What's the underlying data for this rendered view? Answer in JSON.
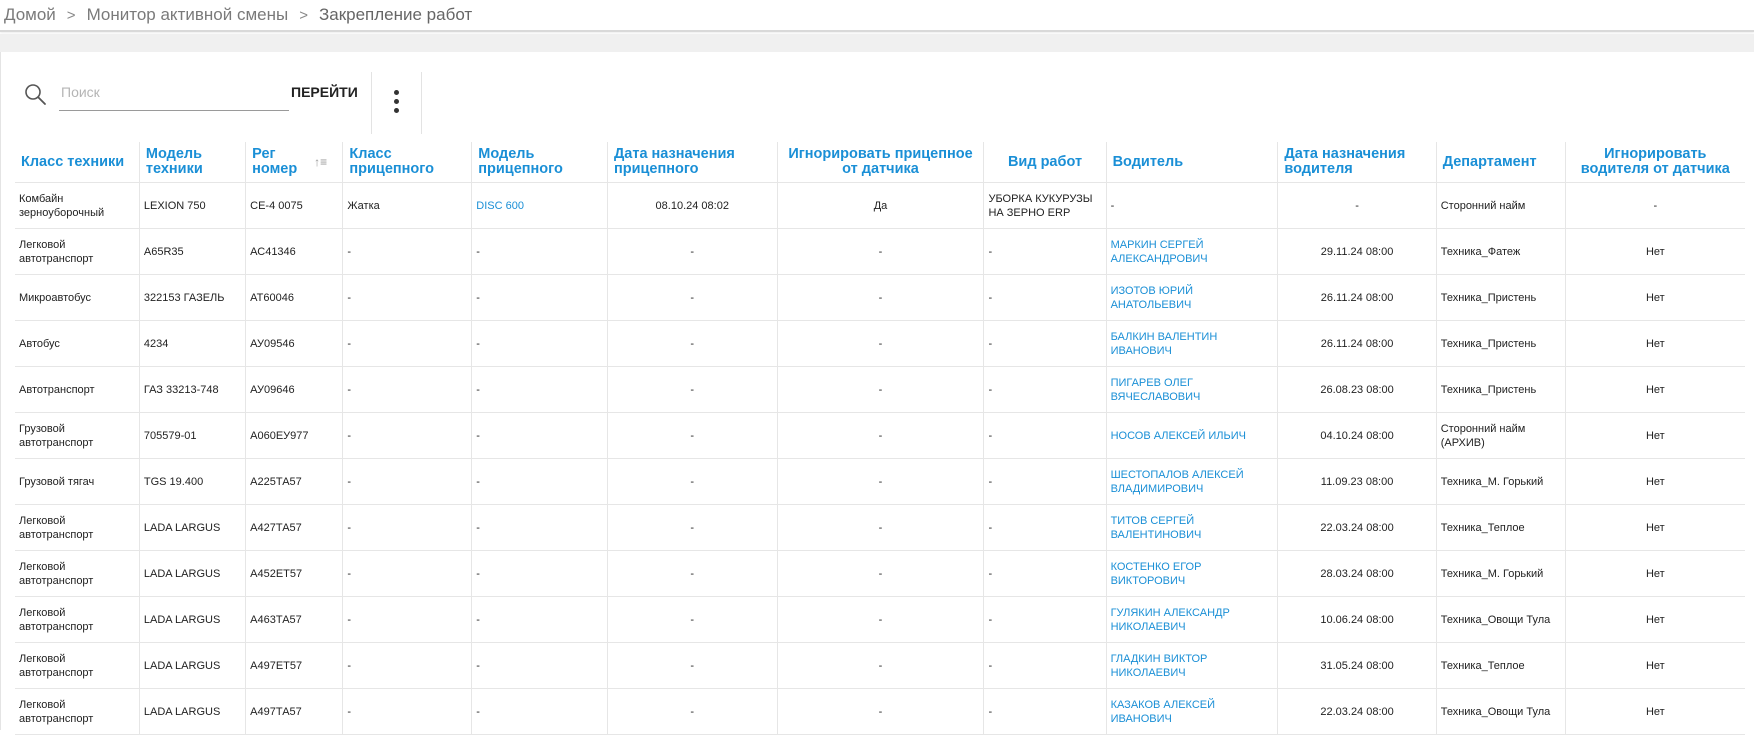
{
  "breadcrumb": {
    "items": [
      "Домой",
      "Монитор активной смены",
      "Закрепление работ"
    ],
    "separator": ">"
  },
  "toolbar": {
    "search_placeholder": "Поиск",
    "search_value": "",
    "go_label": "ПЕРЕЙТИ",
    "menu_icon": "vertical-dots-icon",
    "search_icon": "search-icon"
  },
  "table": {
    "columns": [
      "Класс техники",
      "Модель техники",
      "Рег номер",
      "Класс прицепного",
      "Модель прицепного",
      "Дата назначения прицепного",
      "Игнорировать прицепное от датчика",
      "Вид работ",
      "Водитель",
      "Дата назначения водителя",
      "Департамент",
      "Игнорировать водителя от датчика"
    ],
    "sorted_column": "Рег номер",
    "rows": [
      [
        "Комбайн зерноуборочный",
        "LEXION 750",
        "СЕ-4 0075",
        "Жатка",
        "DISC 600",
        "08.10.24 08:02",
        "Да",
        "УБОРКА КУКУРУЗЫ НА ЗЕРНО ERP",
        "-",
        "-",
        "Сторонний найм",
        "-"
      ],
      [
        "Легковой автотранспорт",
        "A65R35",
        "АС41346",
        "-",
        "-",
        "-",
        "-",
        "-",
        "МАРКИН СЕРГЕЙ АЛЕКСАНДРОВИЧ",
        "29.11.24 08:00",
        "Техника_Фатеж",
        "Нет"
      ],
      [
        "Микроавтобус",
        "322153 ГАЗЕЛЬ",
        "АТ60046",
        "-",
        "-",
        "-",
        "-",
        "-",
        "ИЗОТОВ ЮРИЙ АНАТОЛЬЕВИЧ",
        "26.11.24 08:00",
        "Техника_Пристень",
        "Нет"
      ],
      [
        "Автобус",
        "4234",
        "АУ09546",
        "-",
        "-",
        "-",
        "-",
        "-",
        "БАЛКИН ВАЛЕНТИН ИВАНОВИЧ",
        "26.11.24 08:00",
        "Техника_Пристень",
        "Нет"
      ],
      [
        "Автотранспорт",
        "ГАЗ 33213-748",
        "АУ09646",
        "-",
        "-",
        "-",
        "-",
        "-",
        "ПИГАРЕВ ОЛЕГ ВЯЧЕСЛАВОВИЧ",
        "26.08.23 08:00",
        "Техника_Пристень",
        "Нет"
      ],
      [
        "Грузовой автотранспорт",
        "705579-01",
        "А060ЕУ977",
        "-",
        "-",
        "-",
        "-",
        "-",
        "НОСОВ АЛЕКСЕЙ ИЛЬИЧ",
        "04.10.24 08:00",
        "Сторонний найм (АРХИВ)",
        "Нет"
      ],
      [
        "Грузовой тягач",
        "TGS 19.400",
        "А225ТА57",
        "-",
        "-",
        "-",
        "-",
        "-",
        "ШЕСТОПАЛОВ АЛЕКСЕЙ ВЛАДИМИРОВИЧ",
        "11.09.23 08:00",
        "Техника_М. Горький",
        "Нет"
      ],
      [
        "Легковой автотранспорт",
        "LADA LARGUS",
        "А427ТА57",
        "-",
        "-",
        "-",
        "-",
        "-",
        "ТИТОВ СЕРГЕЙ ВАЛЕНТИНОВИЧ",
        "22.03.24 08:00",
        "Техника_Теплое",
        "Нет"
      ],
      [
        "Легковой автотранспорт",
        "LADA LARGUS",
        "А452ЕТ57",
        "-",
        "-",
        "-",
        "-",
        "-",
        "КОСТЕНКО ЕГОР ВИКТОРОВИЧ",
        "28.03.24 08:00",
        "Техника_М. Горький",
        "Нет"
      ],
      [
        "Легковой автотранспорт",
        "LADA LARGUS",
        "А463ТА57",
        "-",
        "-",
        "-",
        "-",
        "-",
        "ГУЛЯКИН АЛЕКСАНДР НИКОЛАЕВИЧ",
        "10.06.24 08:00",
        "Техника_Овощи Тула",
        "Нет"
      ],
      [
        "Легковой автотранспорт",
        "LADA LARGUS",
        "А497ЕТ57",
        "-",
        "-",
        "-",
        "-",
        "-",
        "ГЛАДКИН ВИКТОР НИКОЛАЕВИЧ",
        "31.05.24 08:00",
        "Техника_Теплое",
        "Нет"
      ],
      [
        "Легковой автотранспорт",
        "LADA LARGUS",
        "А497ТА57",
        "-",
        "-",
        "-",
        "-",
        "-",
        "КАЗАКОВ АЛЕКСЕЙ ИВАНОВИЧ",
        "22.03.24 08:00",
        "Техника_Овощи Тула",
        "Нет"
      ]
    ]
  },
  "colors": {
    "accent": "#1a8fd6",
    "text": "#222222",
    "muted": "#7a7a7a"
  }
}
